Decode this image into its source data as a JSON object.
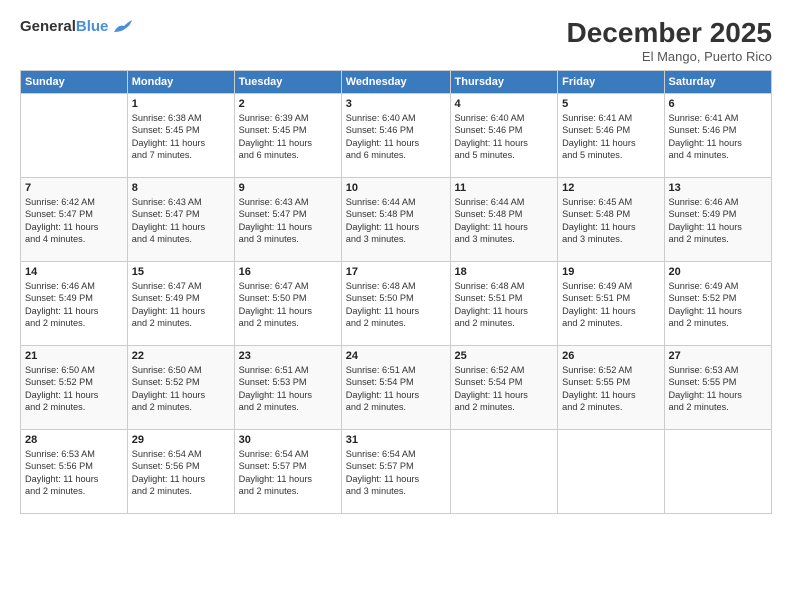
{
  "logo": {
    "line1": "General",
    "line2": "Blue"
  },
  "title": "December 2025",
  "subtitle": "El Mango, Puerto Rico",
  "days_header": [
    "Sunday",
    "Monday",
    "Tuesday",
    "Wednesday",
    "Thursday",
    "Friday",
    "Saturday"
  ],
  "weeks": [
    [
      {
        "num": "",
        "info": ""
      },
      {
        "num": "1",
        "info": "Sunrise: 6:38 AM\nSunset: 5:45 PM\nDaylight: 11 hours\nand 7 minutes."
      },
      {
        "num": "2",
        "info": "Sunrise: 6:39 AM\nSunset: 5:45 PM\nDaylight: 11 hours\nand 6 minutes."
      },
      {
        "num": "3",
        "info": "Sunrise: 6:40 AM\nSunset: 5:46 PM\nDaylight: 11 hours\nand 6 minutes."
      },
      {
        "num": "4",
        "info": "Sunrise: 6:40 AM\nSunset: 5:46 PM\nDaylight: 11 hours\nand 5 minutes."
      },
      {
        "num": "5",
        "info": "Sunrise: 6:41 AM\nSunset: 5:46 PM\nDaylight: 11 hours\nand 5 minutes."
      },
      {
        "num": "6",
        "info": "Sunrise: 6:41 AM\nSunset: 5:46 PM\nDaylight: 11 hours\nand 4 minutes."
      }
    ],
    [
      {
        "num": "7",
        "info": "Sunrise: 6:42 AM\nSunset: 5:47 PM\nDaylight: 11 hours\nand 4 minutes."
      },
      {
        "num": "8",
        "info": "Sunrise: 6:43 AM\nSunset: 5:47 PM\nDaylight: 11 hours\nand 4 minutes."
      },
      {
        "num": "9",
        "info": "Sunrise: 6:43 AM\nSunset: 5:47 PM\nDaylight: 11 hours\nand 3 minutes."
      },
      {
        "num": "10",
        "info": "Sunrise: 6:44 AM\nSunset: 5:48 PM\nDaylight: 11 hours\nand 3 minutes."
      },
      {
        "num": "11",
        "info": "Sunrise: 6:44 AM\nSunset: 5:48 PM\nDaylight: 11 hours\nand 3 minutes."
      },
      {
        "num": "12",
        "info": "Sunrise: 6:45 AM\nSunset: 5:48 PM\nDaylight: 11 hours\nand 3 minutes."
      },
      {
        "num": "13",
        "info": "Sunrise: 6:46 AM\nSunset: 5:49 PM\nDaylight: 11 hours\nand 2 minutes."
      }
    ],
    [
      {
        "num": "14",
        "info": "Sunrise: 6:46 AM\nSunset: 5:49 PM\nDaylight: 11 hours\nand 2 minutes."
      },
      {
        "num": "15",
        "info": "Sunrise: 6:47 AM\nSunset: 5:49 PM\nDaylight: 11 hours\nand 2 minutes."
      },
      {
        "num": "16",
        "info": "Sunrise: 6:47 AM\nSunset: 5:50 PM\nDaylight: 11 hours\nand 2 minutes."
      },
      {
        "num": "17",
        "info": "Sunrise: 6:48 AM\nSunset: 5:50 PM\nDaylight: 11 hours\nand 2 minutes."
      },
      {
        "num": "18",
        "info": "Sunrise: 6:48 AM\nSunset: 5:51 PM\nDaylight: 11 hours\nand 2 minutes."
      },
      {
        "num": "19",
        "info": "Sunrise: 6:49 AM\nSunset: 5:51 PM\nDaylight: 11 hours\nand 2 minutes."
      },
      {
        "num": "20",
        "info": "Sunrise: 6:49 AM\nSunset: 5:52 PM\nDaylight: 11 hours\nand 2 minutes."
      }
    ],
    [
      {
        "num": "21",
        "info": "Sunrise: 6:50 AM\nSunset: 5:52 PM\nDaylight: 11 hours\nand 2 minutes."
      },
      {
        "num": "22",
        "info": "Sunrise: 6:50 AM\nSunset: 5:52 PM\nDaylight: 11 hours\nand 2 minutes."
      },
      {
        "num": "23",
        "info": "Sunrise: 6:51 AM\nSunset: 5:53 PM\nDaylight: 11 hours\nand 2 minutes."
      },
      {
        "num": "24",
        "info": "Sunrise: 6:51 AM\nSunset: 5:54 PM\nDaylight: 11 hours\nand 2 minutes."
      },
      {
        "num": "25",
        "info": "Sunrise: 6:52 AM\nSunset: 5:54 PM\nDaylight: 11 hours\nand 2 minutes."
      },
      {
        "num": "26",
        "info": "Sunrise: 6:52 AM\nSunset: 5:55 PM\nDaylight: 11 hours\nand 2 minutes."
      },
      {
        "num": "27",
        "info": "Sunrise: 6:53 AM\nSunset: 5:55 PM\nDaylight: 11 hours\nand 2 minutes."
      }
    ],
    [
      {
        "num": "28",
        "info": "Sunrise: 6:53 AM\nSunset: 5:56 PM\nDaylight: 11 hours\nand 2 minutes."
      },
      {
        "num": "29",
        "info": "Sunrise: 6:54 AM\nSunset: 5:56 PM\nDaylight: 11 hours\nand 2 minutes."
      },
      {
        "num": "30",
        "info": "Sunrise: 6:54 AM\nSunset: 5:57 PM\nDaylight: 11 hours\nand 2 minutes."
      },
      {
        "num": "31",
        "info": "Sunrise: 6:54 AM\nSunset: 5:57 PM\nDaylight: 11 hours\nand 3 minutes."
      },
      {
        "num": "",
        "info": ""
      },
      {
        "num": "",
        "info": ""
      },
      {
        "num": "",
        "info": ""
      }
    ]
  ]
}
